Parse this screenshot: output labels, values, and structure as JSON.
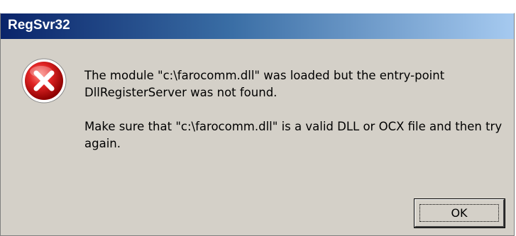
{
  "dialog": {
    "title": "RegSvr32",
    "icon": "error-icon",
    "message_line1": "The module \"c:\\farocomm.dll\" was loaded but the entry-point DllRegisterServer was not found.",
    "message_line2": "Make sure that \"c:\\farocomm.dll\" is a valid DLL or OCX file and then try again.",
    "ok_label": "OK"
  },
  "colors": {
    "title_gradient_start": "#0a246a",
    "title_gradient_end": "#a6caf0",
    "dialog_background": "#d4d0c8",
    "error_icon_red": "#cc1f1f"
  }
}
